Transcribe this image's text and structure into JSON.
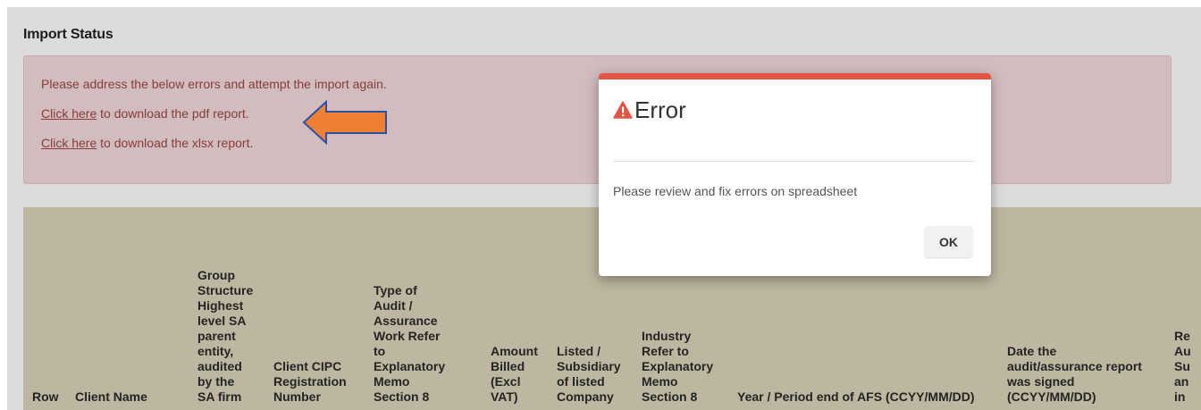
{
  "panel": {
    "title": "Import Status"
  },
  "alert": {
    "message": "Please address the below errors and attempt the import again.",
    "pdf_link": "Click here",
    "pdf_text": " to download the pdf report.",
    "xlsx_link": "Click here",
    "xlsx_text": " to download the xlsx report.",
    "colors": {
      "background": "#d1bcbe",
      "text": "#8a3b3b"
    }
  },
  "annotation": {
    "arrow_color": "#ee8032",
    "arrow_outline": "#2e4fa8"
  },
  "table": {
    "columns": [
      {
        "lines": [
          "Row"
        ]
      },
      {
        "lines": [
          "Client Name"
        ]
      },
      {
        "lines": [
          "Group",
          "Structure",
          "Highest",
          "level SA",
          "parent",
          "entity,",
          "audited",
          "by the",
          "SA firm"
        ]
      },
      {
        "lines": [
          "Client CIPC",
          "Registration",
          "Number"
        ]
      },
      {
        "lines": [
          "Type of",
          "Audit /",
          "Assurance",
          "Work Refer",
          "to",
          "Explanatory",
          "Memo",
          "Section 8"
        ]
      },
      {
        "lines": [
          "Amount",
          "Billed",
          "(Excl",
          "VAT)"
        ]
      },
      {
        "lines": [
          "Listed /",
          "Subsidiary",
          "of listed",
          "Company"
        ]
      },
      {
        "lines": [
          "Industry",
          "Refer to",
          "Explanatory",
          "Memo",
          "Section 8"
        ]
      },
      {
        "lines": [
          "Year / Period end of AFS (CCYY/MM/DD)"
        ]
      },
      {
        "lines": [
          "Date the",
          "audit/assurance report",
          "was signed",
          "(CCYY/MM/DD)"
        ]
      },
      {
        "lines": [
          "Re",
          "Au",
          "Su",
          "an",
          "in"
        ]
      }
    ],
    "header_bg": "#bdb6a0"
  },
  "modal": {
    "title": "Error",
    "message": "Please review and fix errors on spreadsheet",
    "ok_label": "OK",
    "icon": "warning-triangle-icon",
    "accent": "#e45444"
  }
}
